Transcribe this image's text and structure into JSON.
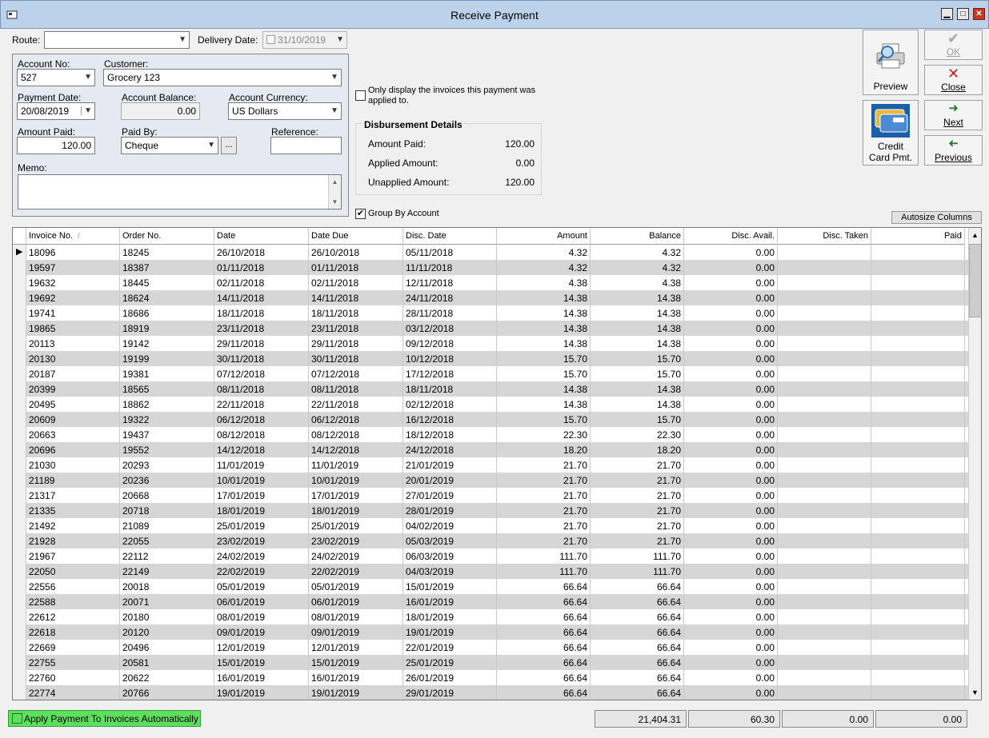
{
  "window": {
    "title": "Receive Payment"
  },
  "route": {
    "label": "Route:",
    "value": ""
  },
  "delivery_date": {
    "label": "Delivery Date:",
    "value": "31/10/2019"
  },
  "account": {
    "account_no_label": "Account No:",
    "account_no": "527",
    "customer_label": "Customer:",
    "customer": "Grocery 123",
    "payment_date_label": "Payment Date:",
    "payment_date": "20/08/2019",
    "account_balance_label": "Account Balance:",
    "account_balance": "0.00",
    "account_currency_label": "Account Currency:",
    "account_currency": "US Dollars",
    "amount_paid_label": "Amount Paid:",
    "amount_paid": "120.00",
    "paid_by_label": "Paid By:",
    "paid_by": "Cheque",
    "ellipsis": "...",
    "reference_label": "Reference:",
    "reference": "",
    "memo_label": "Memo:",
    "memo": ""
  },
  "only_display": {
    "label_line1": "Only display the invoices this payment was",
    "label_line2": "applied to.",
    "checked": false
  },
  "disbursement": {
    "title": "Disbursement Details",
    "amount_paid_label": "Amount Paid:",
    "amount_paid": "120.00",
    "applied_label": "Applied Amount:",
    "applied": "0.00",
    "unapplied_label": "Unapplied Amount:",
    "unapplied": "120.00"
  },
  "group_by": {
    "label": "Group By Account",
    "checked": true,
    "check_glyph": "✔"
  },
  "autosize_label": "Autosize Columns",
  "buttons": {
    "preview": "Preview",
    "ok": "OK",
    "close": "Close",
    "next": "Next",
    "credit_line1": "Credit",
    "credit_line2": "Card Pmt.",
    "previous": "Previous"
  },
  "grid": {
    "columns": [
      "Invoice No.",
      "Order No.",
      "Date",
      "Date Due",
      "Disc. Date",
      "Amount",
      "Balance",
      "Disc. Avail.",
      "Disc. Taken",
      "Paid"
    ],
    "sort_glyph": "/",
    "current_row_glyph": "▶",
    "rows": [
      [
        "18096",
        "18245",
        "26/10/2018",
        "26/10/2018",
        "05/11/2018",
        "4.32",
        "4.32",
        "0.00",
        "",
        ""
      ],
      [
        "19597",
        "18387",
        "01/11/2018",
        "01/11/2018",
        "11/11/2018",
        "4.32",
        "4.32",
        "0.00",
        "",
        ""
      ],
      [
        "19632",
        "18445",
        "02/11/2018",
        "02/11/2018",
        "12/11/2018",
        "4.38",
        "4.38",
        "0.00",
        "",
        ""
      ],
      [
        "19692",
        "18624",
        "14/11/2018",
        "14/11/2018",
        "24/11/2018",
        "14.38",
        "14.38",
        "0.00",
        "",
        ""
      ],
      [
        "19741",
        "18686",
        "18/11/2018",
        "18/11/2018",
        "28/11/2018",
        "14.38",
        "14.38",
        "0.00",
        "",
        ""
      ],
      [
        "19865",
        "18919",
        "23/11/2018",
        "23/11/2018",
        "03/12/2018",
        "14.38",
        "14.38",
        "0.00",
        "",
        ""
      ],
      [
        "20113",
        "19142",
        "29/11/2018",
        "29/11/2018",
        "09/12/2018",
        "14.38",
        "14.38",
        "0.00",
        "",
        ""
      ],
      [
        "20130",
        "19199",
        "30/11/2018",
        "30/11/2018",
        "10/12/2018",
        "15.70",
        "15.70",
        "0.00",
        "",
        ""
      ],
      [
        "20187",
        "19381",
        "07/12/2018",
        "07/12/2018",
        "17/12/2018",
        "15.70",
        "15.70",
        "0.00",
        "",
        ""
      ],
      [
        "20399",
        "18565",
        "08/11/2018",
        "08/11/2018",
        "18/11/2018",
        "14.38",
        "14.38",
        "0.00",
        "",
        ""
      ],
      [
        "20495",
        "18862",
        "22/11/2018",
        "22/11/2018",
        "02/12/2018",
        "14.38",
        "14.38",
        "0.00",
        "",
        ""
      ],
      [
        "20609",
        "19322",
        "06/12/2018",
        "06/12/2018",
        "16/12/2018",
        "15.70",
        "15.70",
        "0.00",
        "",
        ""
      ],
      [
        "20663",
        "19437",
        "08/12/2018",
        "08/12/2018",
        "18/12/2018",
        "22.30",
        "22.30",
        "0.00",
        "",
        ""
      ],
      [
        "20696",
        "19552",
        "14/12/2018",
        "14/12/2018",
        "24/12/2018",
        "18.20",
        "18.20",
        "0.00",
        "",
        ""
      ],
      [
        "21030",
        "20293",
        "11/01/2019",
        "11/01/2019",
        "21/01/2019",
        "21.70",
        "21.70",
        "0.00",
        "",
        ""
      ],
      [
        "21189",
        "20236",
        "10/01/2019",
        "10/01/2019",
        "20/01/2019",
        "21.70",
        "21.70",
        "0.00",
        "",
        ""
      ],
      [
        "21317",
        "20668",
        "17/01/2019",
        "17/01/2019",
        "27/01/2019",
        "21.70",
        "21.70",
        "0.00",
        "",
        ""
      ],
      [
        "21335",
        "20718",
        "18/01/2019",
        "18/01/2019",
        "28/01/2019",
        "21.70",
        "21.70",
        "0.00",
        "",
        ""
      ],
      [
        "21492",
        "21089",
        "25/01/2019",
        "25/01/2019",
        "04/02/2019",
        "21.70",
        "21.70",
        "0.00",
        "",
        ""
      ],
      [
        "21928",
        "22055",
        "23/02/2019",
        "23/02/2019",
        "05/03/2019",
        "21.70",
        "21.70",
        "0.00",
        "",
        ""
      ],
      [
        "21967",
        "22112",
        "24/02/2019",
        "24/02/2019",
        "06/03/2019",
        "111.70",
        "111.70",
        "0.00",
        "",
        ""
      ],
      [
        "22050",
        "22149",
        "22/02/2019",
        "22/02/2019",
        "04/03/2019",
        "111.70",
        "111.70",
        "0.00",
        "",
        ""
      ],
      [
        "22556",
        "20018",
        "05/01/2019",
        "05/01/2019",
        "15/01/2019",
        "66.64",
        "66.64",
        "0.00",
        "",
        ""
      ],
      [
        "22588",
        "20071",
        "06/01/2019",
        "06/01/2019",
        "16/01/2019",
        "66.64",
        "66.64",
        "0.00",
        "",
        ""
      ],
      [
        "22612",
        "20180",
        "08/01/2019",
        "08/01/2019",
        "18/01/2019",
        "66.64",
        "66.64",
        "0.00",
        "",
        ""
      ],
      [
        "22618",
        "20120",
        "09/01/2019",
        "09/01/2019",
        "19/01/2019",
        "66.64",
        "66.64",
        "0.00",
        "",
        ""
      ],
      [
        "22669",
        "20496",
        "12/01/2019",
        "12/01/2019",
        "22/01/2019",
        "66.64",
        "66.64",
        "0.00",
        "",
        ""
      ],
      [
        "22755",
        "20581",
        "15/01/2019",
        "15/01/2019",
        "25/01/2019",
        "66.64",
        "66.64",
        "0.00",
        "",
        ""
      ],
      [
        "22760",
        "20622",
        "16/01/2019",
        "16/01/2019",
        "26/01/2019",
        "66.64",
        "66.64",
        "0.00",
        "",
        ""
      ],
      [
        "22774",
        "20766",
        "19/01/2019",
        "19/01/2019",
        "29/01/2019",
        "66.64",
        "66.64",
        "0.00",
        "",
        ""
      ]
    ]
  },
  "totals": {
    "amount": "21,404.31",
    "disc_avail": "60.30",
    "disc_taken": "0.00",
    "paid": "0.00"
  },
  "apply_auto": {
    "label": "Apply Payment To Invoices Automatically",
    "checked": false
  },
  "colors": {
    "titlebar": "#bcd1ea",
    "apply_highlight": "#5ee05e",
    "row_alt": "#d6d6d6",
    "close_red": "#c23b22"
  }
}
